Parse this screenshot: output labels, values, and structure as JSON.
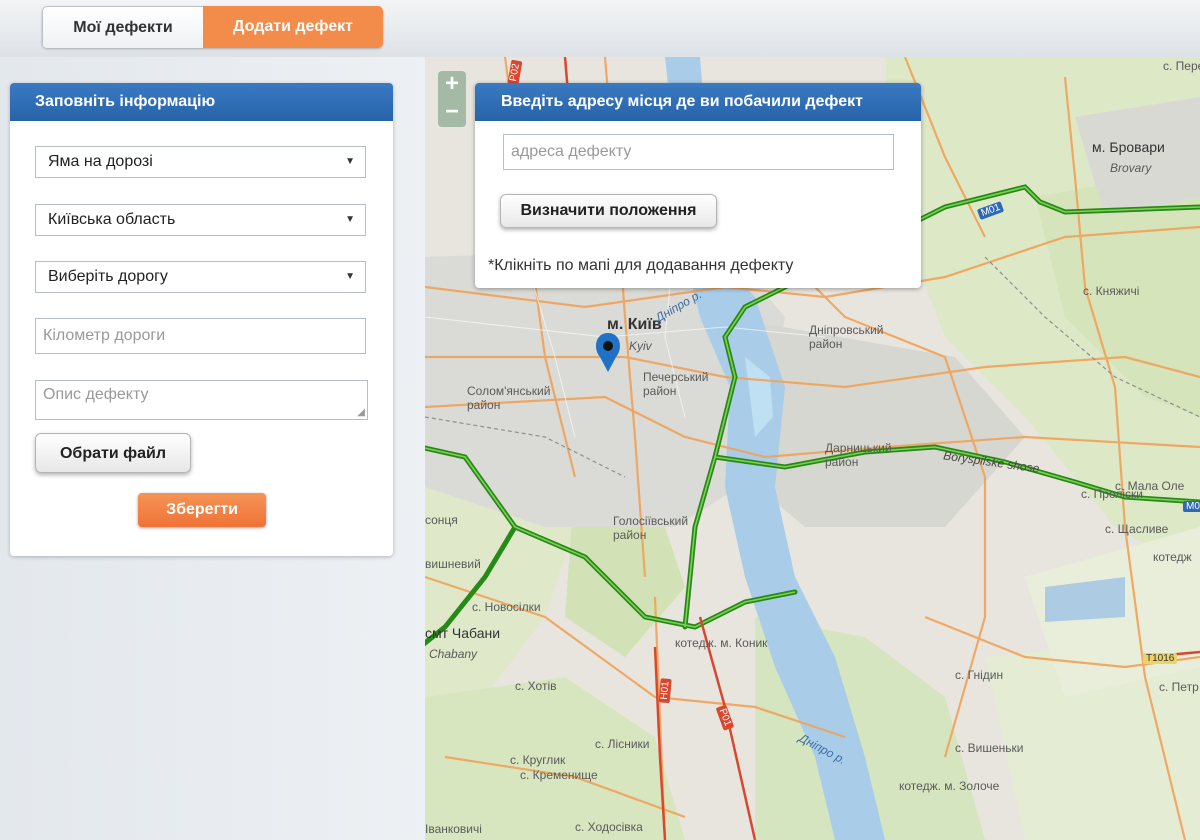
{
  "tabs": {
    "my_defects": "Мої дефекти",
    "add_defect": "Додати дефект"
  },
  "form": {
    "title": "Заповніть інформацію",
    "defect_type": "Яма на дорозі",
    "region": "Київська область",
    "road": "Виберіть дорогу",
    "km_placeholder": "Кілометр дороги",
    "description_placeholder": "Опис дефекту",
    "choose_file": "Обрати файл",
    "save": "Зберегти"
  },
  "map": {
    "zoom_in": "+",
    "zoom_out": "−",
    "address_popup": {
      "title": "Введіть адресу місця де ви побачили дефект",
      "placeholder": "адреса дефекту",
      "locate_button": "Визначити положення",
      "note": "*Клікніть по мапі для додавання дефекту"
    },
    "labels": {
      "kyiv": "м. Київ",
      "kyiv_lat": "Kyiv",
      "brovary": "м. Бровари",
      "brovary_lat": "Brovary",
      "kniazhychi": "с. Княжичі",
      "dniprovskyi": "Дніпровський район",
      "pecherskyi": "Печерський район",
      "solomianskyi": "Солом'янський район",
      "darnytskyi": "Дарницький район",
      "holosiivskyi": "Голосіївський район",
      "novosilky": "с. Новосілки",
      "chabany": "смт Чабани",
      "chabany_lat": "Chabany",
      "khotiv": "с. Хотів",
      "lisnyky": "с. Лісники",
      "kruhlyk": "с. Круглик",
      "kremenyshche": "с. Кременище",
      "khodosivka": "с. Ходосівка",
      "koniak": "котедж. м. Коник",
      "hnidyn": "с. Гнідин",
      "vyshenky": "с. Вишеньки",
      "petr": "с. Петр",
      "pere": "с. Пере",
      "shchaslyve": "с. Щасливе",
      "proliski": "с. Проліски",
      "mala_ole": "с. Мала Оле",
      "zoloche": "котедж. м. Золоче",
      "borispilske": "Boryspilske shose",
      "dnipro1": "Дніпро р.",
      "dnipro2": "Дніпро р.",
      "vyshnevyi": "вишневий",
      "sontsia": "сонця",
      "kotedzh": "котедж",
      "ivankovychi": "Іванковичі"
    },
    "shields": {
      "m01": "M01",
      "m03": "M03",
      "r02": "P02",
      "n01": "H01",
      "p01": "P01",
      "t1016": "T1016"
    }
  },
  "colors": {
    "accent_orange": "#f38c4a",
    "header_blue": "#2f6fb6",
    "highway_green": "#2e8b1f"
  }
}
